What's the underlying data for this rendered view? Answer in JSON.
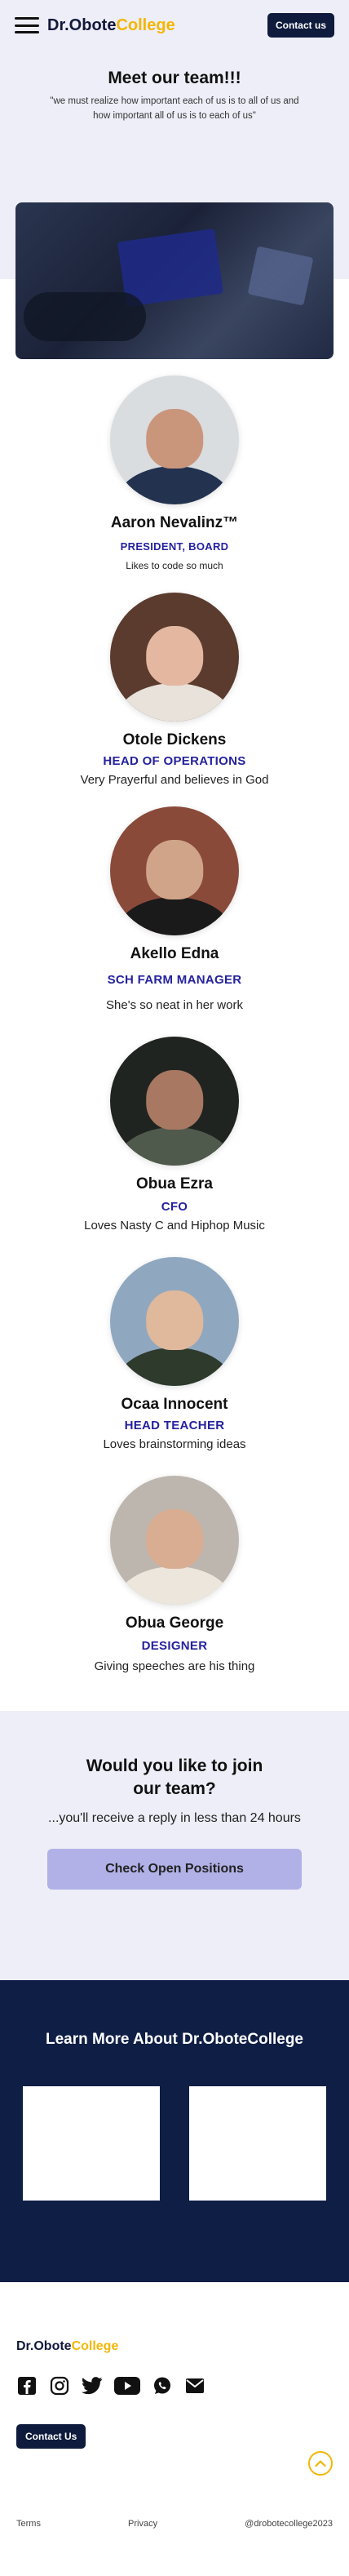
{
  "header": {
    "logo_part1": "Dr.Obote",
    "logo_part2": "College",
    "contact_label": "Contact us"
  },
  "hero": {
    "title": "Meet our team!!!",
    "quote": "\"we must realize how important each of us is to all of us and how important all of us is to each of us\""
  },
  "team": [
    {
      "name": "Aaron Nevalinz™",
      "role": "PRESIDENT, BOARD",
      "desc": "Likes to code so much"
    },
    {
      "name": "Otole Dickens",
      "role": "HEAD OF OPERATIONS",
      "desc": "Very Prayerful and believes in God"
    },
    {
      "name": "Akello Edna",
      "role": "SCH FARM MANAGER",
      "desc": "She's so neat in her work"
    },
    {
      "name": "Obua Ezra",
      "role": "CFO",
      "desc": "Loves Nasty C and Hiphop Music"
    },
    {
      "name": "Ocaa Innocent",
      "role": "HEAD TEACHER",
      "desc": "Loves brainstorming ideas"
    },
    {
      "name": "Obua George",
      "role": "DESIGNER",
      "desc": "Giving speeches are his thing"
    }
  ],
  "join": {
    "title_line1": "Would you like to join",
    "title_line2": "our team?",
    "subtitle": "...you'll receive a reply in less than 24 hours",
    "button_label": "Check Open Positions"
  },
  "learn": {
    "title": "Learn More About Dr.OboteCollege"
  },
  "footer": {
    "logo_part1": "Dr.Obote",
    "logo_part2": "College",
    "contact_label": "Contact Us",
    "links": [
      "Terms",
      "Privacy",
      "@drobotecollege2023"
    ],
    "socials": [
      "facebook-icon",
      "instagram-icon",
      "twitter-icon",
      "youtube-icon",
      "whatsapp-icon",
      "mail-icon"
    ]
  },
  "colors": {
    "navy": "#0f1b3d",
    "accent_yellow": "#f2b705",
    "role_blue": "#25229e",
    "light_bg": "#eeeef8",
    "button_lavender": "#b1b1e8"
  }
}
